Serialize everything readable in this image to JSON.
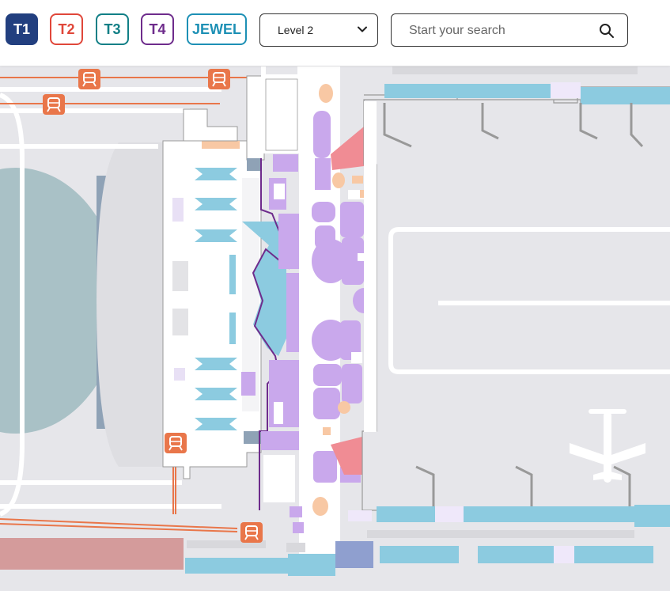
{
  "terminal_tabs": [
    {
      "label": "T1",
      "color": "#223f7f",
      "selected": true
    },
    {
      "label": "T2",
      "color": "#e0473a",
      "selected": false
    },
    {
      "label": "T3",
      "color": "#117f86",
      "selected": false
    },
    {
      "label": "T4",
      "color": "#6e2c8c",
      "selected": false
    },
    {
      "label": "JEWEL",
      "color": "#1d90b5",
      "selected": false
    }
  ],
  "level_select": {
    "value": "Level 2",
    "icon": "chevron-down-icon"
  },
  "search": {
    "placeholder": "Start your search",
    "value": "",
    "icon": "search-icon"
  },
  "map": {
    "icons": [
      "train-icon",
      "airplane-icon"
    ],
    "colors": {
      "ground": "#e6e6ea",
      "walkway": "#ffffff",
      "shops": "#c9a8ec",
      "gates": "#8ccbe0",
      "food": "#f8c8a4",
      "services": "#f08c94",
      "train_line": "#e9764a",
      "terminal_outline": "#6e2c8c"
    }
  }
}
